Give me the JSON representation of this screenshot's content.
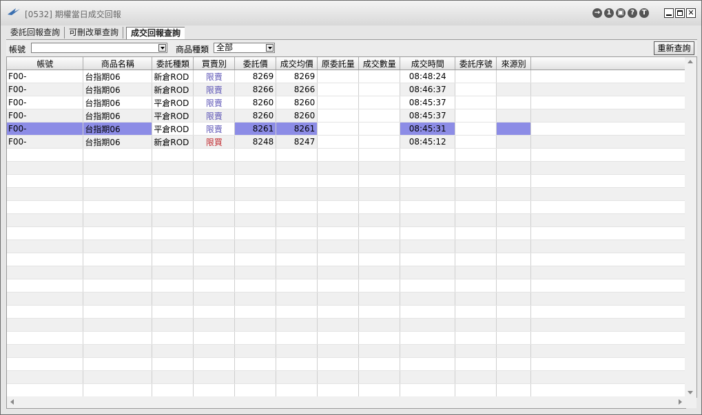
{
  "window": {
    "title": "[0532] 期權當日成交回報"
  },
  "titlebar_icons": [
    "→",
    "1",
    "▣",
    "?",
    "T"
  ],
  "tabs": [
    {
      "label": "委託回報查詢"
    },
    {
      "label": "可刪改單查詢"
    },
    {
      "label": "成交回報查詢"
    }
  ],
  "toolbar": {
    "account_label": "帳號",
    "account_value": "",
    "product_type_label": "商品種類",
    "product_type_value": "全部",
    "refresh_label": "重新查詢"
  },
  "table": {
    "columns": [
      "帳號",
      "商品名稱",
      "委託種類",
      "買賣別",
      "委託價",
      "成交均價",
      "原委託量",
      "成交數量",
      "成交時間",
      "委託序號",
      "來源別"
    ],
    "rows": [
      {
        "account": "F00-",
        "product": "台指期06",
        "order_type": "新倉ROD",
        "side": "限賣",
        "side_type": "sell",
        "order_price": "8269",
        "avg_price": "8269",
        "time": "08:48:24"
      },
      {
        "account": "F00-",
        "product": "台指期06",
        "order_type": "新倉ROD",
        "side": "限賣",
        "side_type": "sell",
        "order_price": "8266",
        "avg_price": "8266",
        "time": "08:46:37"
      },
      {
        "account": "F00-",
        "product": "台指期06",
        "order_type": "平倉ROD",
        "side": "限賣",
        "side_type": "sell",
        "order_price": "8260",
        "avg_price": "8260",
        "time": "08:45:37"
      },
      {
        "account": "F00-",
        "product": "台指期06",
        "order_type": "平倉ROD",
        "side": "限賣",
        "side_type": "sell",
        "order_price": "8260",
        "avg_price": "8260",
        "time": "08:45:37"
      },
      {
        "account": "F00-",
        "product": "台指期06",
        "order_type": "平倉ROD",
        "side": "限賣",
        "side_type": "sell",
        "order_price": "8261",
        "avg_price": "8261",
        "time": "08:45:31",
        "selected": true
      },
      {
        "account": "F00-",
        "product": "台指期06",
        "order_type": "新倉ROD",
        "side": "限買",
        "side_type": "buy",
        "order_price": "8248",
        "avg_price": "8247",
        "time": "08:45:12"
      }
    ]
  },
  "colors": {
    "selected_row": "#8c8ce6",
    "sell_text": "#5a52b5",
    "buy_text": "#c0282d"
  }
}
